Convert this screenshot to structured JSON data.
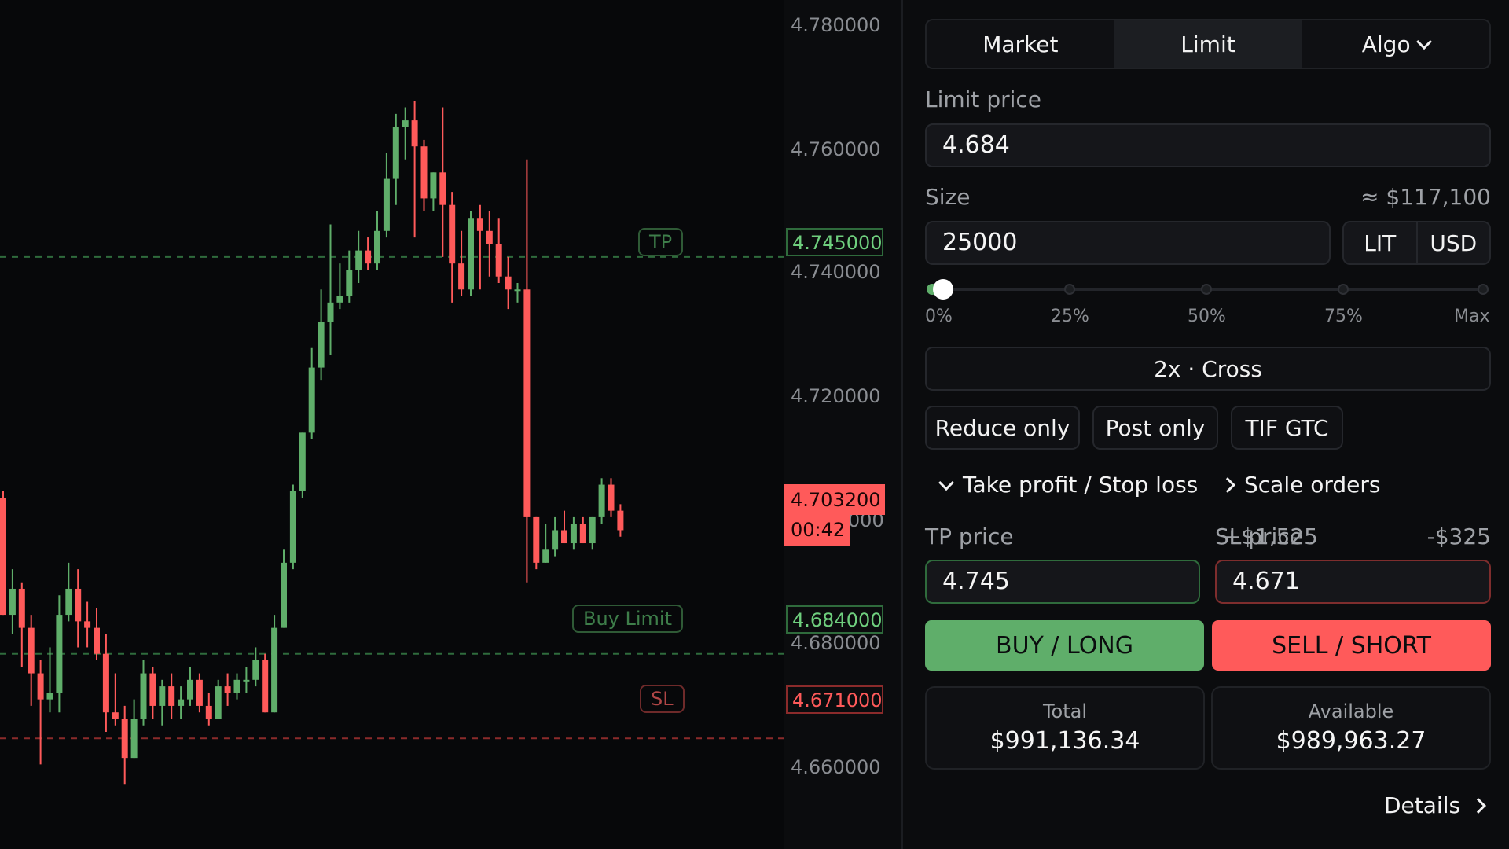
{
  "chart": {
    "axis_labels": [
      "4.780000",
      "4.760000",
      "4.740000",
      "4.720000",
      "4.000",
      "4.680000",
      "4.660000"
    ],
    "tp": {
      "label": "TP",
      "price": "4.745000"
    },
    "buy_limit": {
      "label": "Buy Limit",
      "price": "4.684000"
    },
    "sl": {
      "label": "SL",
      "price": "4.671000"
    },
    "current": {
      "price": "4.703200",
      "countdown": "00:42"
    },
    "colors": {
      "up": "#5fae6a",
      "down": "#ff5a5a"
    }
  },
  "chart_data": {
    "type": "candlestick",
    "y_range": [
      4.654,
      4.7845
    ],
    "candles": [
      {
        "o": 4.708,
        "h": 4.709,
        "l": 4.69,
        "c": 4.69
      },
      {
        "o": 4.69,
        "h": 4.697,
        "l": 4.687,
        "c": 4.694
      },
      {
        "o": 4.694,
        "h": 4.695,
        "l": 4.682,
        "c": 4.688
      },
      {
        "o": 4.688,
        "h": 4.69,
        "l": 4.676,
        "c": 4.681
      },
      {
        "o": 4.681,
        "h": 4.683,
        "l": 4.667,
        "c": 4.677
      },
      {
        "o": 4.677,
        "h": 4.685,
        "l": 4.675,
        "c": 4.678
      },
      {
        "o": 4.678,
        "h": 4.693,
        "l": 4.675,
        "c": 4.69
      },
      {
        "o": 4.69,
        "h": 4.698,
        "l": 4.689,
        "c": 4.694
      },
      {
        "o": 4.694,
        "h": 4.697,
        "l": 4.685,
        "c": 4.689
      },
      {
        "o": 4.689,
        "h": 4.692,
        "l": 4.685,
        "c": 4.688
      },
      {
        "o": 4.688,
        "h": 4.691,
        "l": 4.683,
        "c": 4.684
      },
      {
        "o": 4.684,
        "h": 4.687,
        "l": 4.672,
        "c": 4.675
      },
      {
        "o": 4.675,
        "h": 4.681,
        "l": 4.673,
        "c": 4.674
      },
      {
        "o": 4.674,
        "h": 4.676,
        "l": 4.664,
        "c": 4.668
      },
      {
        "o": 4.668,
        "h": 4.677,
        "l": 4.668,
        "c": 4.674
      },
      {
        "o": 4.674,
        "h": 4.683,
        "l": 4.673,
        "c": 4.681
      },
      {
        "o": 4.681,
        "h": 4.682,
        "l": 4.674,
        "c": 4.676
      },
      {
        "o": 4.676,
        "h": 4.68,
        "l": 4.673,
        "c": 4.679
      },
      {
        "o": 4.679,
        "h": 4.681,
        "l": 4.674,
        "c": 4.676
      },
      {
        "o": 4.676,
        "h": 4.679,
        "l": 4.674,
        "c": 4.677
      },
      {
        "o": 4.677,
        "h": 4.682,
        "l": 4.676,
        "c": 4.68
      },
      {
        "o": 4.68,
        "h": 4.681,
        "l": 4.675,
        "c": 4.676
      },
      {
        "o": 4.676,
        "h": 4.678,
        "l": 4.673,
        "c": 4.674
      },
      {
        "o": 4.674,
        "h": 4.68,
        "l": 4.674,
        "c": 4.679
      },
      {
        "o": 4.679,
        "h": 4.681,
        "l": 4.676,
        "c": 4.678
      },
      {
        "o": 4.678,
        "h": 4.681,
        "l": 4.677,
        "c": 4.68
      },
      {
        "o": 4.68,
        "h": 4.682,
        "l": 4.678,
        "c": 4.68
      },
      {
        "o": 4.68,
        "h": 4.685,
        "l": 4.679,
        "c": 4.683
      },
      {
        "o": 4.683,
        "h": 4.684,
        "l": 4.675,
        "c": 4.675
      },
      {
        "o": 4.675,
        "h": 4.69,
        "l": 4.675,
        "c": 4.688
      },
      {
        "o": 4.688,
        "h": 4.7,
        "l": 4.688,
        "c": 4.698
      },
      {
        "o": 4.698,
        "h": 4.71,
        "l": 4.697,
        "c": 4.709
      },
      {
        "o": 4.709,
        "h": 4.716,
        "l": 4.708,
        "c": 4.718
      },
      {
        "o": 4.718,
        "h": 4.731,
        "l": 4.717,
        "c": 4.728
      },
      {
        "o": 4.728,
        "h": 4.74,
        "l": 4.726,
        "c": 4.735
      },
      {
        "o": 4.735,
        "h": 4.75,
        "l": 4.73,
        "c": 4.738
      },
      {
        "o": 4.738,
        "h": 4.744,
        "l": 4.737,
        "c": 4.739
      },
      {
        "o": 4.739,
        "h": 4.746,
        "l": 4.738,
        "c": 4.743
      },
      {
        "o": 4.743,
        "h": 4.749,
        "l": 4.741,
        "c": 4.746
      },
      {
        "o": 4.746,
        "h": 4.748,
        "l": 4.743,
        "c": 4.744
      },
      {
        "o": 4.744,
        "h": 4.752,
        "l": 4.743,
        "c": 4.749
      },
      {
        "o": 4.749,
        "h": 4.761,
        "l": 4.748,
        "c": 4.757
      },
      {
        "o": 4.757,
        "h": 4.767,
        "l": 4.753,
        "c": 4.765
      },
      {
        "o": 4.765,
        "h": 4.768,
        "l": 4.76,
        "c": 4.766
      },
      {
        "o": 4.766,
        "h": 4.769,
        "l": 4.748,
        "c": 4.762
      },
      {
        "o": 4.762,
        "h": 4.763,
        "l": 4.752,
        "c": 4.754
      },
      {
        "o": 4.754,
        "h": 4.758,
        "l": 4.752,
        "c": 4.758
      },
      {
        "o": 4.758,
        "h": 4.768,
        "l": 4.745,
        "c": 4.753
      },
      {
        "o": 4.753,
        "h": 4.755,
        "l": 4.738,
        "c": 4.744
      },
      {
        "o": 4.744,
        "h": 4.749,
        "l": 4.739,
        "c": 4.74
      },
      {
        "o": 4.74,
        "h": 4.752,
        "l": 4.739,
        "c": 4.751
      },
      {
        "o": 4.751,
        "h": 4.753,
        "l": 4.74,
        "c": 4.749
      },
      {
        "o": 4.749,
        "h": 4.752,
        "l": 4.742,
        "c": 4.747
      },
      {
        "o": 4.747,
        "h": 4.751,
        "l": 4.741,
        "c": 4.742
      },
      {
        "o": 4.742,
        "h": 4.745,
        "l": 4.737,
        "c": 4.74
      },
      {
        "o": 4.74,
        "h": 4.741,
        "l": 4.738,
        "c": 4.74
      },
      {
        "o": 4.74,
        "h": 4.76,
        "l": 4.695,
        "c": 4.705
      },
      {
        "o": 4.705,
        "h": 4.705,
        "l": 4.697,
        "c": 4.698
      },
      {
        "o": 4.698,
        "h": 4.704,
        "l": 4.698,
        "c": 4.7
      },
      {
        "o": 4.7,
        "h": 4.705,
        "l": 4.699,
        "c": 4.703
      },
      {
        "o": 4.703,
        "h": 4.706,
        "l": 4.701,
        "c": 4.701
      },
      {
        "o": 4.701,
        "h": 4.705,
        "l": 4.7,
        "c": 4.704
      },
      {
        "o": 4.704,
        "h": 4.705,
        "l": 4.701,
        "c": 4.701
      },
      {
        "o": 4.701,
        "h": 4.705,
        "l": 4.7,
        "c": 4.705
      },
      {
        "o": 4.705,
        "h": 4.711,
        "l": 4.704,
        "c": 4.71
      },
      {
        "o": 4.71,
        "h": 4.711,
        "l": 4.705,
        "c": 4.706
      },
      {
        "o": 4.706,
        "h": 4.707,
        "l": 4.702,
        "c": 4.703
      }
    ]
  },
  "order_type": {
    "options": [
      "Market",
      "Limit",
      "Algo"
    ],
    "active": "Limit"
  },
  "limit_price": {
    "label": "Limit price",
    "value": "4.684"
  },
  "size": {
    "label": "Size",
    "approx_value": "≈ $117,100",
    "value": "25000",
    "units": [
      "LIT",
      "USD"
    ]
  },
  "slider": {
    "value_fraction": 0.03,
    "tick_labels": [
      "0%",
      "25%",
      "50%",
      "75%",
      "Max"
    ]
  },
  "leverage": {
    "label": "2x · Cross"
  },
  "flags": [
    "Reduce only",
    "Post only",
    "TIF GTC"
  ],
  "disclosures": {
    "tp_sl": "Take profit / Stop loss",
    "scale": "Scale orders"
  },
  "tp_price": {
    "label": "TP price",
    "pnl": "+$1,525",
    "value": "4.745"
  },
  "sl_price": {
    "label": "SL price",
    "pnl": "-$325",
    "value": "4.671"
  },
  "actions": {
    "buy": "BUY / LONG",
    "sell": "SELL / SHORT",
    "buy_color": "#5fae6a",
    "sell_color": "#ff5a5a"
  },
  "balances": {
    "total_label": "Total",
    "total_value": "$991,136.34",
    "available_label": "Available",
    "available_value": "$989,963.27"
  },
  "details_link": "Details"
}
